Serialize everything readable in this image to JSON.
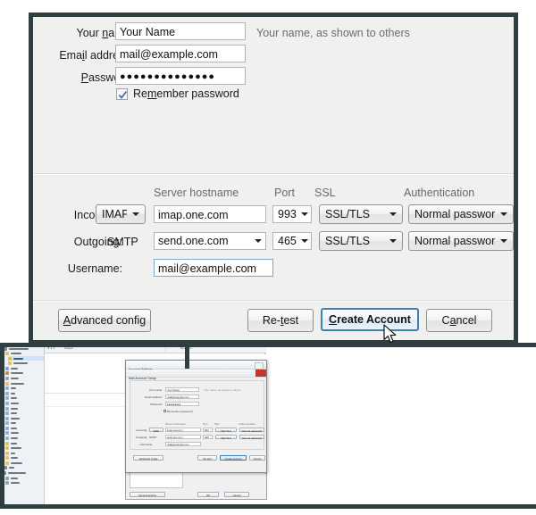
{
  "dialog": {
    "account_section": {
      "fields": [
        {
          "label": "Your name:",
          "label_accel": "n",
          "value": "Your Name",
          "hint": "Your name, as shown to others"
        },
        {
          "label": "Email address:",
          "label_accel": "i",
          "value": "mail@example.com",
          "hint": ""
        },
        {
          "label": "Password:",
          "label_accel": "P",
          "value": "●●●●●●●●●●●●●●",
          "hint": ""
        }
      ],
      "remember_password": {
        "label": "Remember password",
        "checked": true
      }
    },
    "server_section": {
      "column_headers": {
        "hostname": "Server hostname",
        "port": "Port",
        "ssl": "SSL",
        "auth": "Authentication"
      },
      "rows": [
        {
          "label": "Incoming:",
          "protocol": "IMAP",
          "protocol_is_dropdown": true,
          "hostname": "imap.one.com",
          "hostname_is_dropdown": false,
          "port": "993",
          "ssl": "SSL/TLS",
          "auth": "Normal password"
        },
        {
          "label": "Outgoing:",
          "protocol": "SMTP",
          "protocol_is_dropdown": false,
          "hostname": "send.one.com",
          "hostname_is_dropdown": true,
          "port": "465",
          "ssl": "SSL/TLS",
          "auth": "Normal password"
        }
      ],
      "username": {
        "label": "Username:",
        "value": "mail@example.com"
      }
    },
    "buttons": {
      "advanced": "Advanced config",
      "advanced_accel": "A",
      "retest": "Re-test",
      "retest_accel": "t",
      "create": "Create Account",
      "create_accel": "C",
      "cancel": "Cancel",
      "cancel_accel": "a"
    },
    "colors": {
      "border": "#2f3e3e",
      "dialog_bg": "#f0f0ee",
      "default_button_border": "#3c7fb1",
      "hint_text": "#6d6d6d"
    }
  },
  "thumbnail": {
    "window_title": "",
    "list_columns": [
      "Subject",
      "Recipient"
    ],
    "account_settings_dialog": {
      "title": "Account Settings",
      "subtitle": "Mail Account Setup",
      "fields": [
        {
          "label": "Your name:",
          "value": "Your Name",
          "hint": "Your name, as shown to others"
        },
        {
          "label": "Email address:",
          "value": "mail@example.com"
        },
        {
          "label": "Password:",
          "value": "●●●●●●●●●"
        }
      ],
      "remember_password": "Remember password",
      "column_headers": {
        "hostname": "Server hostname",
        "port": "Port",
        "ssl": "SSL",
        "auth": "Authentication"
      },
      "rows": [
        {
          "label": "Incoming:",
          "protocol": "IMAP",
          "hostname": "imap.one.com",
          "port": "993",
          "ssl": "SSL/TLS",
          "auth": "Normal password"
        },
        {
          "label": "Outgoing:",
          "protocol": "SMTP",
          "hostname": "send.one.com",
          "port": "465",
          "ssl": "SSL/TLS",
          "auth": "Normal password"
        }
      ],
      "username": {
        "label": "Username:",
        "value": "mail@example.com"
      },
      "buttons": {
        "advanced": "Advanced config",
        "retest": "Re-test",
        "create": "Create Account",
        "cancel": "Cancel"
      }
    },
    "lower_dialog": {
      "manage_identities": "Manage Identities...",
      "account_actions": "Account Actions",
      "ok": "OK",
      "cancel": "Cancel"
    },
    "folder_tree": {
      "root": "Mail Account",
      "selected_item": "Drafts"
    }
  }
}
